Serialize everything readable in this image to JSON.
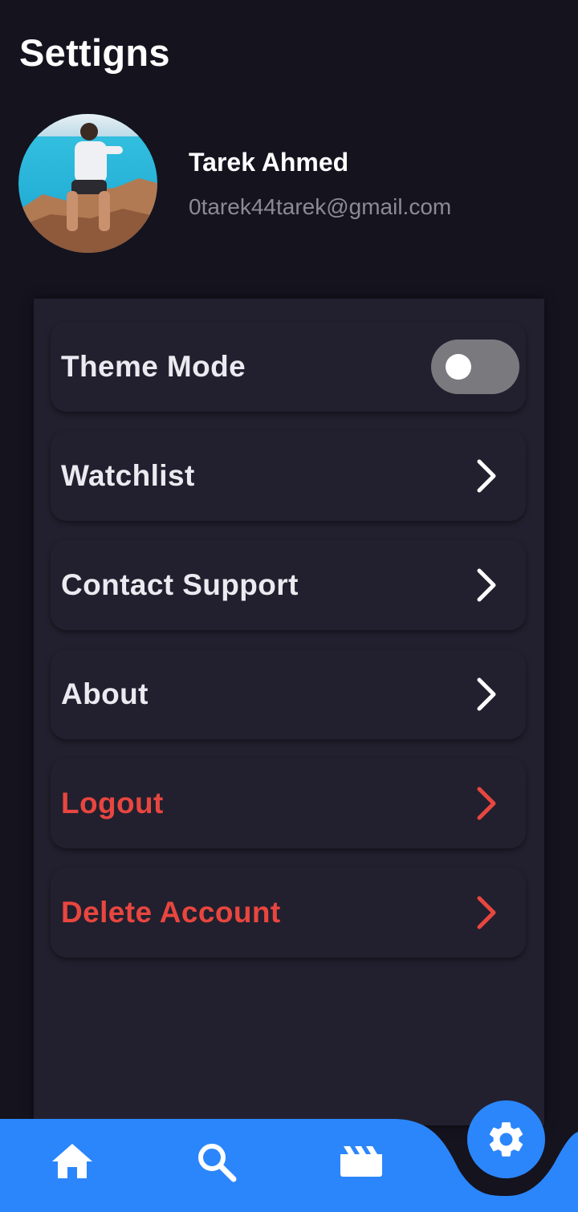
{
  "header": {
    "title": "Settigns"
  },
  "profile": {
    "name": "Tarek Ahmed",
    "email": "0tarek44tarek@gmail.com",
    "avatar_icon": "profile-photo"
  },
  "settings": {
    "items": [
      {
        "label": "Theme Mode",
        "control": "toggle",
        "toggle_on": false
      },
      {
        "label": "Watchlist",
        "control": "chevron-right-icon"
      },
      {
        "label": "Contact Support",
        "control": "chevron-right-icon"
      },
      {
        "label": "About",
        "control": "chevron-right-icon"
      },
      {
        "label": "Logout",
        "control": "chevron-right-icon",
        "danger": true
      },
      {
        "label": "Delete Account",
        "control": "chevron-right-icon",
        "danger": true
      }
    ]
  },
  "bottom_nav": {
    "items": [
      {
        "icon": "home-icon"
      },
      {
        "icon": "search-icon"
      },
      {
        "icon": "movie-clapper-icon"
      },
      {
        "icon": "gear-icon",
        "active": true
      }
    ]
  },
  "colors": {
    "background": "#15131e",
    "panel": "#22202e",
    "accent": "#2b86fb",
    "danger": "#e8463f",
    "secondary_text": "#8c8a96"
  }
}
